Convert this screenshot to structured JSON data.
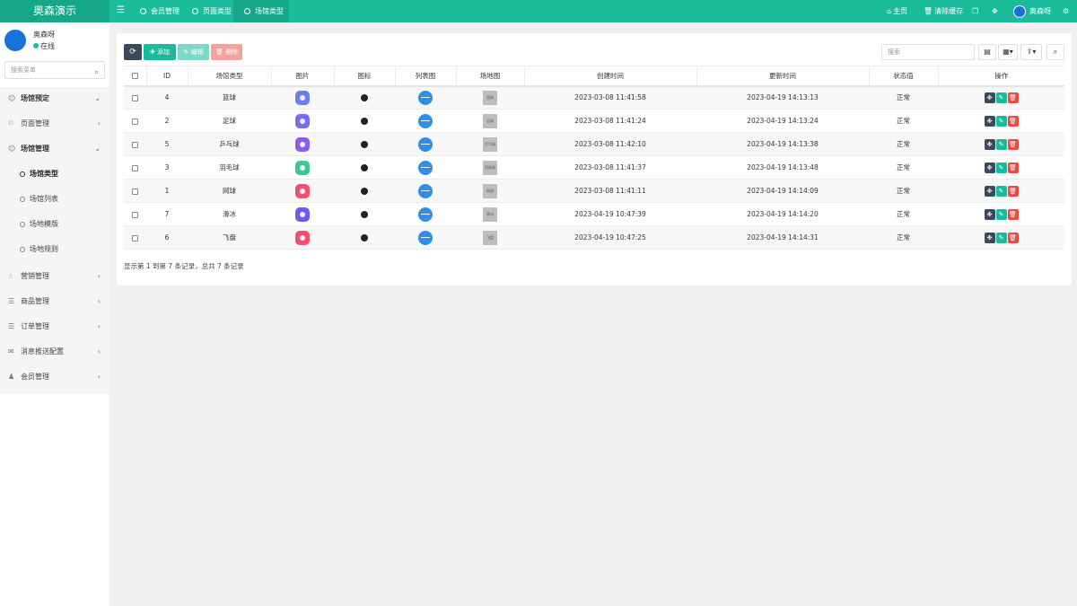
{
  "brand": "奥森演示",
  "top_tabs": [
    "会员管理",
    "页面类型",
    "场馆类型"
  ],
  "top_right": {
    "home": "主页",
    "clear_cache": "清除缓存",
    "username": "奥森呀"
  },
  "user": {
    "name": "奥森呀",
    "status": "在线"
  },
  "sidebar": {
    "search_placeholder": "搜索菜单",
    "items": [
      {
        "label": "场馆预定",
        "icon": "smile-icon",
        "bold": true
      },
      {
        "label": "页面管理",
        "icon": "bookmark-icon"
      },
      {
        "label": "场馆管理",
        "icon": "smile-icon",
        "bold": true
      },
      {
        "label": "场馆类型",
        "sub": true,
        "active": true
      },
      {
        "label": "场馆列表",
        "sub": true
      },
      {
        "label": "场地模版",
        "sub": true
      },
      {
        "label": "场地规则",
        "sub": true
      },
      {
        "label": "营销管理",
        "icon": "hand-icon"
      },
      {
        "label": "商品管理",
        "icon": "list-icon"
      },
      {
        "label": "订单管理",
        "icon": "list-icon"
      },
      {
        "label": "消息推送配置",
        "icon": "comment-icon"
      },
      {
        "label": "会员管理",
        "icon": "user-icon"
      }
    ]
  },
  "toolbar": {
    "add": "添加",
    "edit": "编辑",
    "delete": "删除",
    "search_placeholder": "搜索"
  },
  "table": {
    "headers": [
      "ID",
      "场馆类型",
      "图片",
      "图标",
      "列表图",
      "场地图",
      "创建时间",
      "更新时间",
      "状态值",
      "操作"
    ],
    "rows": [
      {
        "id": "4",
        "type": "篮球",
        "pic_color": "#6c7ff0",
        "venue_label": "篮球",
        "created": "2023-03-08 11:41:58",
        "updated": "2023-04-19 14:13:13",
        "status": "正常"
      },
      {
        "id": "2",
        "type": "足球",
        "pic_color": "#7a6cf0",
        "venue_label": "足球",
        "created": "2023-03-08 11:41:24",
        "updated": "2023-04-19 14:13:24",
        "status": "正常"
      },
      {
        "id": "5",
        "type": "乒乓球",
        "pic_color": "#8a5cf0",
        "venue_label": "乒乓球",
        "created": "2023-03-08 11:42:10",
        "updated": "2023-04-19 14:13:38",
        "status": "正常"
      },
      {
        "id": "3",
        "type": "羽毛球",
        "pic_color": "#3cc796",
        "venue_label": "羽毛球",
        "created": "2023-03-08 11:41:37",
        "updated": "2023-04-19 14:13:48",
        "status": "正常"
      },
      {
        "id": "1",
        "type": "网球",
        "pic_color": "#f0506e",
        "venue_label": "网球",
        "created": "2023-03-08 11:41:11",
        "updated": "2023-04-19 14:14:09",
        "status": "正常"
      },
      {
        "id": "7",
        "type": "滑冰",
        "pic_color": "#6a5cf0",
        "venue_label": "滑冰",
        "created": "2023-04-19 10:47:39",
        "updated": "2023-04-19 14:14:20",
        "status": "正常"
      },
      {
        "id": "6",
        "type": "飞盘",
        "pic_color": "#f0506e",
        "venue_label": "飞盘",
        "created": "2023-04-19 10:47:25",
        "updated": "2023-04-19 14:14:31",
        "status": "正常"
      }
    ]
  },
  "footer": "显示第 1 到第 7 条记录，总共 7 条记录",
  "colors": {
    "primary": "#1abc9c",
    "dark": "#3a4a5d",
    "danger": "#e74c3c"
  }
}
